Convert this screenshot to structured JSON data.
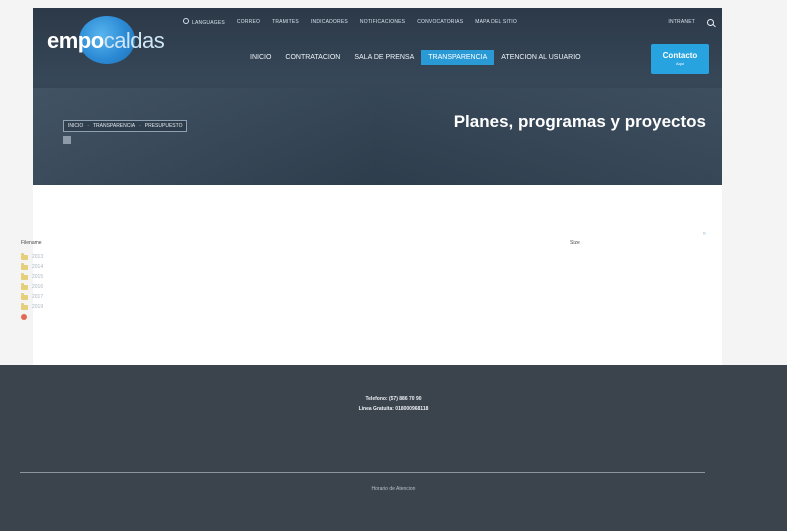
{
  "header": {
    "logo": {
      "part1": "empo",
      "part2": "caldas"
    },
    "topnav": [
      "LANGUAGES",
      "CORREO",
      "TRAMITES",
      "INDICADORES",
      "NOTIFICACIONES",
      "CONVOCATORIAS",
      "MAPA DEL SITIO"
    ],
    "topnav_right": "INTRANET",
    "mainnav": [
      "INICIO",
      "CONTRATACION",
      "SALA DE PRENSA",
      "TRANSPARENCIA",
      "ATENCION AL USUARIO"
    ],
    "mainnav_active": "TRANSPARENCIA",
    "contact": {
      "label": "Contacto",
      "sub": "Aqui"
    }
  },
  "hero": {
    "breadcrumb": [
      "INICIO",
      "TRANSPARENCIA",
      "PRESUPUESTO"
    ],
    "subtag": "",
    "title": "Planes, programas y proyectos"
  },
  "content": {
    "col_filename": "Filename",
    "col_size": "Size",
    "corner_mark": "»",
    "folders": [
      "2013",
      "2014",
      "2015",
      "2016",
      "2017",
      "2019"
    ],
    "empty_notice": ""
  },
  "footer": {
    "phone": "Telefono: (57) 886 70 90",
    "toll_free": "Linea Gratuita: 018000968118",
    "email": "",
    "nit": "",
    "address": "",
    "hours_title": "Horario de Atencion",
    "hours_1": "",
    "hours_2": "",
    "hours_3": ""
  },
  "colors": {
    "accent": "#2a9ad7",
    "hero_bg": "#2e3d4c",
    "footer_bg": "#3b434c"
  }
}
